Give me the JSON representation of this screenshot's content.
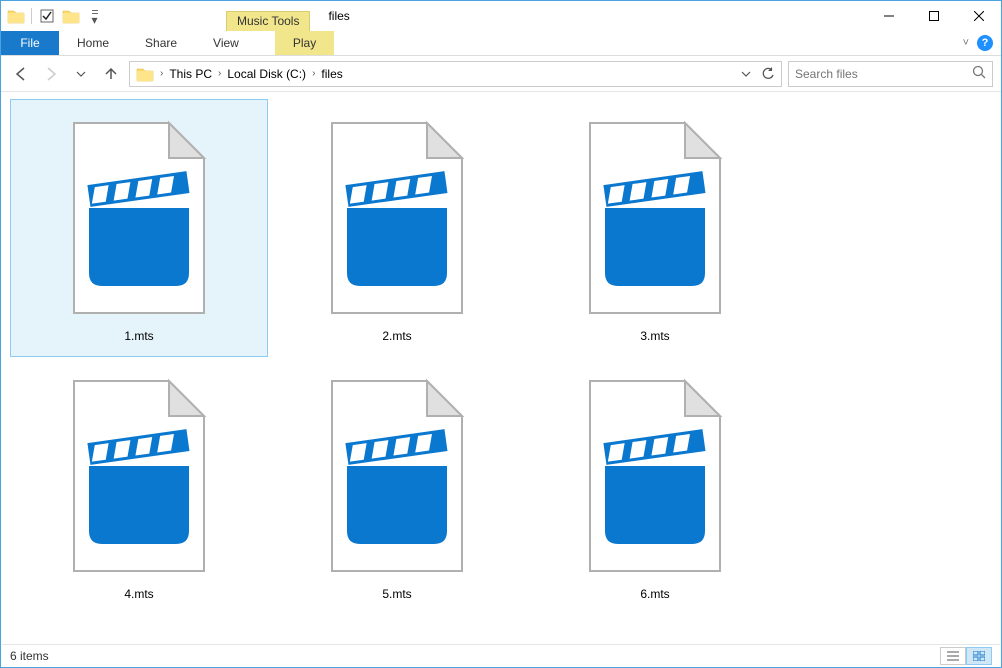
{
  "window": {
    "title": "files",
    "context_tab": "Music Tools"
  },
  "ribbon": {
    "file": "File",
    "tabs": [
      "Home",
      "Share",
      "View"
    ],
    "context_tab": "Play"
  },
  "address": {
    "crumbs": [
      "This PC",
      "Local Disk (C:)",
      "files"
    ]
  },
  "search": {
    "placeholder": "Search files"
  },
  "items": [
    {
      "name": "1.mts",
      "selected": true
    },
    {
      "name": "2.mts",
      "selected": false
    },
    {
      "name": "3.mts",
      "selected": false
    },
    {
      "name": "4.mts",
      "selected": false
    },
    {
      "name": "5.mts",
      "selected": false
    },
    {
      "name": "6.mts",
      "selected": false
    }
  ],
  "status": {
    "text": "6 items"
  }
}
